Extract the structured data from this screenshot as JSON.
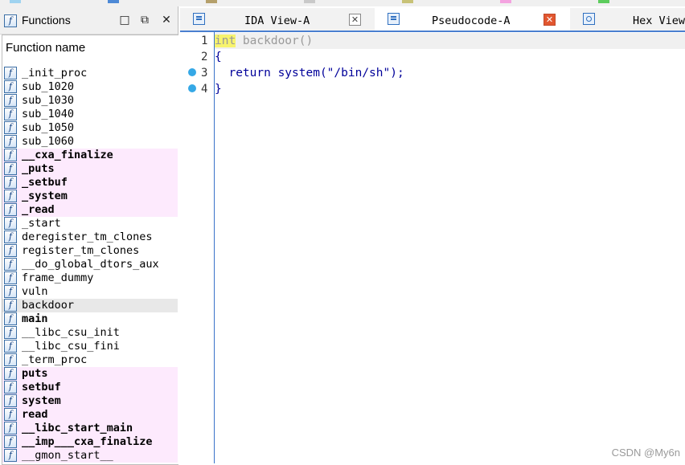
{
  "legend_colors": [
    "#9fd3f0",
    "#4d89d6",
    "#b5a06b",
    "#c9c9c9",
    "#c8c277",
    "#f4a3e0",
    "#5dcc5d"
  ],
  "functions_window": {
    "title": "Functions",
    "column_header": "Function name",
    "rows": [
      {
        "name": "_init_proc",
        "style": "normal"
      },
      {
        "name": "sub_1020",
        "style": "normal"
      },
      {
        "name": "sub_1030",
        "style": "normal"
      },
      {
        "name": "sub_1040",
        "style": "normal"
      },
      {
        "name": "sub_1050",
        "style": "normal"
      },
      {
        "name": "sub_1060",
        "style": "normal"
      },
      {
        "name": "__cxa_finalize",
        "style": "import"
      },
      {
        "name": "_puts",
        "style": "import"
      },
      {
        "name": "_setbuf",
        "style": "import"
      },
      {
        "name": "_system",
        "style": "import"
      },
      {
        "name": "_read",
        "style": "import"
      },
      {
        "name": "_start",
        "style": "normal"
      },
      {
        "name": "deregister_tm_clones",
        "style": "normal"
      },
      {
        "name": "register_tm_clones",
        "style": "normal"
      },
      {
        "name": "__do_global_dtors_aux",
        "style": "normal"
      },
      {
        "name": "frame_dummy",
        "style": "normal"
      },
      {
        "name": "vuln",
        "style": "normal"
      },
      {
        "name": "backdoor",
        "style": "selected"
      },
      {
        "name": "main",
        "style": "bold"
      },
      {
        "name": "__libc_csu_init",
        "style": "normal"
      },
      {
        "name": "__libc_csu_fini",
        "style": "normal"
      },
      {
        "name": "_term_proc",
        "style": "normal"
      },
      {
        "name": "puts",
        "style": "import"
      },
      {
        "name": "setbuf",
        "style": "import"
      },
      {
        "name": "system",
        "style": "import"
      },
      {
        "name": "read",
        "style": "import"
      },
      {
        "name": "__libc_start_main",
        "style": "import"
      },
      {
        "name": "__imp___cxa_finalize",
        "style": "import"
      },
      {
        "name": "__gmon_start__",
        "style": "import-light"
      }
    ]
  },
  "tabs": [
    {
      "label": "IDA View-A",
      "active": false
    },
    {
      "label": "Pseudocode-A",
      "active": true
    },
    {
      "label": "Hex View",
      "active": false
    }
  ],
  "code": {
    "line_numbers": [
      "1",
      "2",
      "3",
      "4"
    ],
    "line1_keyword": "int",
    "line1_rest": " backdoor()",
    "line2": "{",
    "line3": "  return system(\"/bin/sh\");",
    "line4": "}"
  },
  "watermark": "CSDN @My6n"
}
